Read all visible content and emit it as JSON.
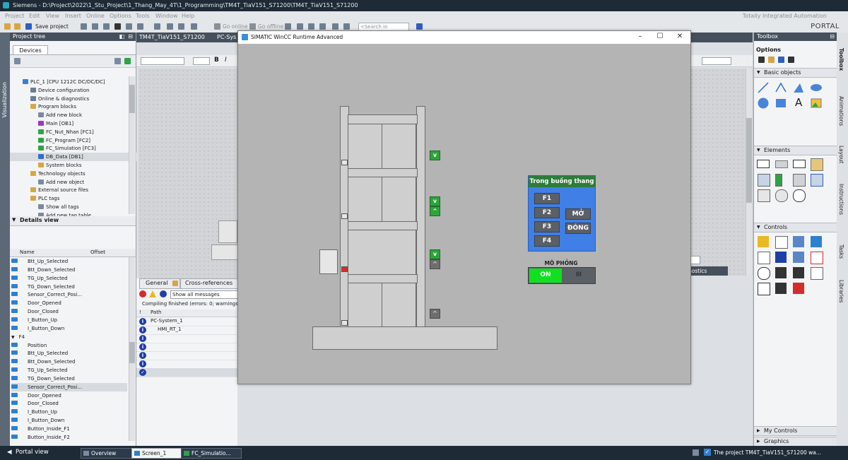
{
  "titlebar": {
    "title": "Siemens  -  D:\\Project\\2022\\1_Stu_Project\\1_Thang_May_4T\\1_Programming\\TM4T_TiaV151_S71200\\TM4T_TiaV151_S71200"
  },
  "menu": [
    "Project",
    "Edit",
    "View",
    "Insert",
    "Online",
    "Options",
    "Tools",
    "Window",
    "Help"
  ],
  "toolbar": {
    "save_label": "Save project",
    "go_online": "Go online",
    "go_offline": "Go offline",
    "search_placeholder": "<Search in project>"
  },
  "brand": {
    "line1": "Totally Integrated Automation",
    "line2": "PORTAL"
  },
  "visualization_tab": "Visualization",
  "project_tree": {
    "title": "Project tree",
    "tab": "Devices",
    "items": [
      {
        "label": "PLC_1 [CPU 1212C DC/DC/DC]",
        "indent": 0,
        "color": "#3c7dd8"
      },
      {
        "label": "Device configuration",
        "indent": 1,
        "color": "#6b7d93"
      },
      {
        "label": "Online & diagnostics",
        "indent": 1,
        "color": "#6b7d93"
      },
      {
        "label": "Program blocks",
        "indent": 1,
        "color": "#d8a640"
      },
      {
        "label": "Add new block",
        "indent": 2,
        "color": "#7a8aa0"
      },
      {
        "label": "Main [OB1]",
        "indent": 2,
        "color": "#9b36c4"
      },
      {
        "label": "FC_Nut_Nhan [FC1]",
        "indent": 2,
        "color": "#2fa344"
      },
      {
        "label": "FC_Program [FC2]",
        "indent": 2,
        "color": "#2fa344"
      },
      {
        "label": "FC_Simulation [FC3]",
        "indent": 2,
        "color": "#2fa344"
      },
      {
        "label": "DB_Data [DB1]",
        "indent": 2,
        "color": "#2f6fcf"
      },
      {
        "label": "System blocks",
        "indent": 2,
        "color": "#d8a640"
      },
      {
        "label": "Technology objects",
        "indent": 1,
        "color": "#d8a640"
      },
      {
        "label": "Add new object",
        "indent": 2,
        "color": "#7a8aa0"
      },
      {
        "label": "External source files",
        "indent": 1,
        "color": "#d8a640"
      },
      {
        "label": "PLC tags",
        "indent": 1,
        "color": "#d8a640"
      },
      {
        "label": "Show all tags",
        "indent": 2,
        "color": "#7a8aa0"
      },
      {
        "label": "Add new tag table",
        "indent": 2,
        "color": "#7a8aa0"
      }
    ]
  },
  "details_view": {
    "title": "Details view",
    "col_name": "Name",
    "col_offset": "Offset",
    "rows": [
      "Btt_Up_Selected",
      "Btt_Down_Selected",
      "TG_Up_Selected",
      "TG_Down_Selected",
      "Sensor_Correct_Posi...",
      "Door_Opened",
      "Door_Closed",
      "I_Button_Up",
      "I_Button_Down",
      "F4",
      "Position",
      "Btt_Up_Selected",
      "Btt_Down_Selected",
      "TG_Up_Selected",
      "TG_Down_Selected",
      "Sensor_Correct_Posi...",
      "Door_Opened",
      "Door_Closed",
      "I_Button_Up",
      "I_Button_Down",
      "Button_Inside_F1",
      "Button_Inside_F2"
    ]
  },
  "editor": {
    "tab1": "TM4T_TiaV151_S71200",
    "tab2": "PC-Sys"
  },
  "inspector": {
    "tab_general": "General",
    "tab_cross": "Cross-references",
    "filter": "Show all messages",
    "compile_msg": "Compiling finished (errors: 0; warnings:",
    "col_path": "Path",
    "row1": "PC-System_1",
    "row2": "HMI_RT_1",
    "diagnostics": "nostics"
  },
  "runtime": {
    "title": "SIMATIC WinCC Runtime Advanced",
    "cabin_panel_title": "Trong buồng thang",
    "floor_buttons": [
      "F1",
      "F2",
      "F3",
      "F4"
    ],
    "open_btn": "MỞ",
    "close_btn": "ĐÓNG",
    "sim_label": "MÔ PHỎNG",
    "toggle_on": "ON",
    "toggle_off": "III",
    "call_v": "v",
    "call_up": "^"
  },
  "toolbox": {
    "title": "Toolbox",
    "options": "Options",
    "basic_objects": "Basic objects",
    "elements": "Elements",
    "controls": "Controls",
    "my_controls": "My Controls",
    "graphics": "Graphics"
  },
  "right_tabs": [
    "Toolbox",
    "Animations",
    "Layout",
    "Instructions",
    "Tasks",
    "Libraries"
  ],
  "statusbar": {
    "portal_view": "Portal view",
    "overview": "Overview",
    "screen1": "Screen_1",
    "fc_sim": "FC_Simulatio...",
    "status_msg": "The project TM4T_TiaV151_S71200 wa..."
  }
}
